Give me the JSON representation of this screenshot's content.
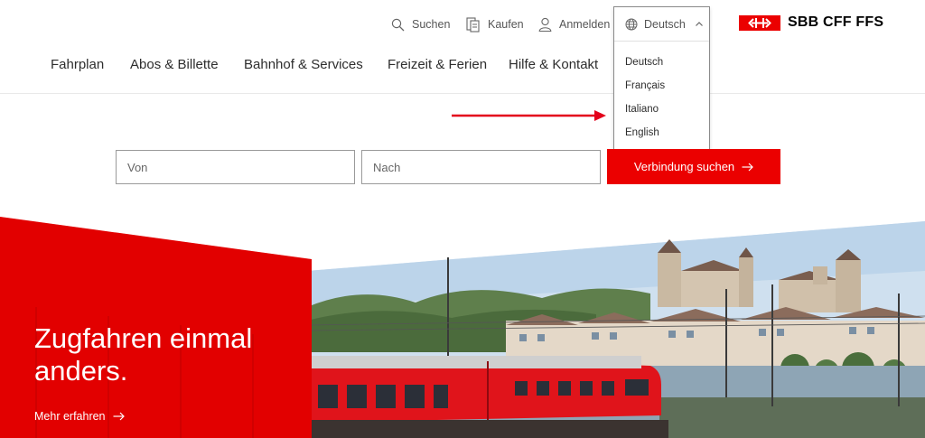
{
  "utility": {
    "search_label": "Suchen",
    "buy_label": "Kaufen",
    "login_label": "Anmelden"
  },
  "brand": {
    "name": "SBB CFF FFS",
    "color": "#eb0000"
  },
  "nav": {
    "items": [
      "Fahrplan",
      "Abos & Billette",
      "Bahnhof & Services",
      "Freizeit & Ferien",
      "Hilfe & Kontakt"
    ]
  },
  "language": {
    "current": "Deutsch",
    "options": [
      "Deutsch",
      "Français",
      "Italiano",
      "English"
    ],
    "expanded": true
  },
  "search": {
    "from_placeholder": "Von",
    "to_placeholder": "Nach",
    "button_label": "Verbindung suchen"
  },
  "hero": {
    "title_line1": "Zugfahren einmal",
    "title_line2": "anders.",
    "link_label": "Mehr erfahren"
  },
  "colors": {
    "accent": "#eb0000",
    "text": "#2d2d2d",
    "muted": "#555555"
  },
  "icons": [
    "search-icon",
    "buy-icon",
    "user-icon",
    "globe-icon",
    "chevron-up-icon",
    "arrow-right-icon",
    "sbb-logo-icon"
  ]
}
